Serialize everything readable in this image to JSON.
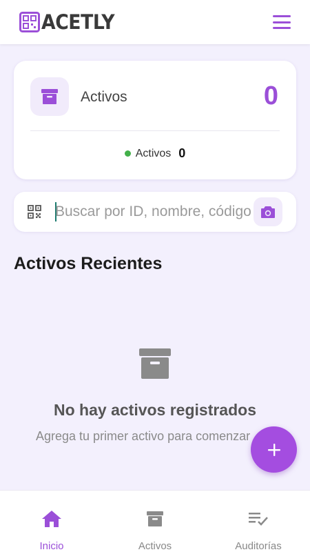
{
  "app": {
    "brand": "ACETLY",
    "colors": {
      "accent": "#9b4fd8",
      "fab": "#a44de0",
      "status_dot": "#43b04a",
      "background": "#f3f0fd"
    }
  },
  "header": {
    "menu_icon": "hamburger-menu-icon",
    "logo_icon": "qr-box-logo-icon"
  },
  "summary_card": {
    "icon": "archive-box-icon",
    "title": "Activos",
    "count": "0",
    "stat": {
      "label": "Activos",
      "value": "0",
      "dot_color": "#43b04a"
    }
  },
  "search": {
    "placeholder": "Buscar por ID, nombre, código",
    "value": "",
    "left_icon": "qr-scan-icon",
    "camera_icon": "camera-icon"
  },
  "recent": {
    "title": "Activos Recientes"
  },
  "empty_state": {
    "icon": "archive-box-icon",
    "title": "No hay activos registrados",
    "subtitle": "Agrega tu primer activo para comenzar"
  },
  "fab": {
    "icon": "plus-icon"
  },
  "bottom_nav": {
    "items": [
      {
        "label": "Inicio",
        "icon": "home-icon",
        "active": true
      },
      {
        "label": "Activos",
        "icon": "archive-box-icon",
        "active": false
      },
      {
        "label": "Auditorías",
        "icon": "checklist-icon",
        "active": false
      }
    ]
  }
}
